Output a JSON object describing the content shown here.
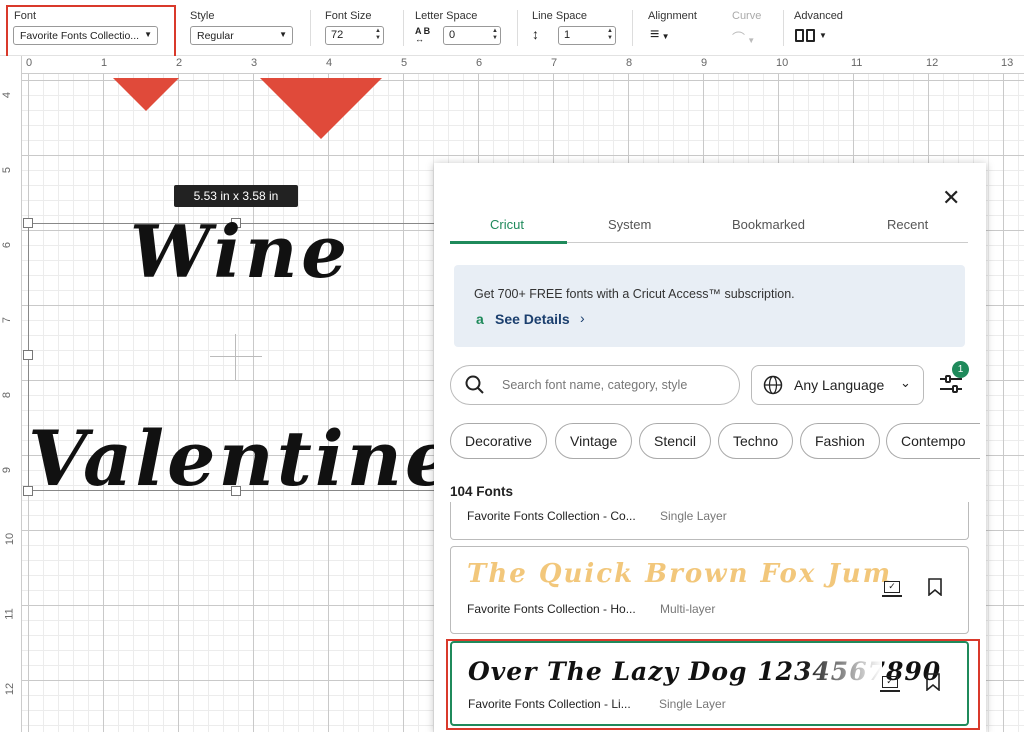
{
  "toolbar": {
    "font_label": "Font",
    "font_value": "Favorite Fonts Collectio...",
    "style_label": "Style",
    "style_value": "Regular",
    "size_label": "Font Size",
    "size_value": "72",
    "letter_label": "Letter Space",
    "letter_value": "0",
    "line_label": "Line Space",
    "line_value": "1",
    "align_label": "Alignment",
    "curve_label": "Curve",
    "advanced_label": "Advanced"
  },
  "ruler": {
    "top": [
      "0",
      "1",
      "2",
      "3",
      "4",
      "5",
      "6",
      "7",
      "8",
      "9",
      "10",
      "11",
      "12",
      "13"
    ],
    "left": [
      "4",
      "5",
      "6",
      "7",
      "8",
      "9",
      "10",
      "11",
      "12"
    ]
  },
  "canvas": {
    "dimensions": "5.53  in x 3.58  in",
    "line1": "Wine",
    "line2": "Valentine"
  },
  "panel": {
    "tabs": [
      "Cricut",
      "System",
      "Bookmarked",
      "Recent"
    ],
    "promo_text": "Get 700+ FREE fonts with a Cricut Access™ subscription.",
    "promo_link": "See Details",
    "search_placeholder": "Search font name, category, style",
    "language": "Any Language",
    "filter_badge": "1",
    "chips": [
      "Decorative",
      "Vintage",
      "Stencil",
      "Techno",
      "Fashion",
      "Contempo"
    ],
    "count": "104 Fonts",
    "fonts": [
      {
        "name": "Favorite Fonts Collection - Co...",
        "type": "Single Layer"
      },
      {
        "name": "Favorite Fonts Collection - Ho...",
        "type": "Multi-layer",
        "preview": "The Quick Brown Fox Jum"
      },
      {
        "name": "Favorite Fonts Collection - Li...",
        "type": "Single Layer",
        "preview": "Over The Lazy Dog 1234567890"
      }
    ]
  },
  "colors": {
    "accent": "#1f8a5b",
    "highlight": "#d9392b",
    "arrow": "#e04a3a",
    "promo_bg": "#e8eef5",
    "link": "#1b3f6e"
  }
}
